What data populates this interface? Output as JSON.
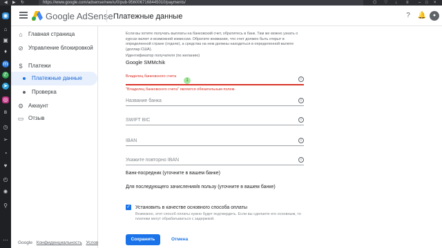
{
  "browser": {
    "url": "https://www.google.com/adsense/new/u/0/pub-9560067168445010/payments/"
  },
  "header": {
    "product_name": "Google AdSense",
    "page_title": "Платежные данные"
  },
  "sidebar": {
    "items": [
      {
        "label": "Главная страница",
        "icon": "home-icon"
      },
      {
        "label": "Управление блокировкой",
        "icon": "block-icon"
      },
      {
        "label": "Платежи",
        "icon": "payments-icon"
      },
      {
        "label": "Платежные данные",
        "icon": "dot"
      },
      {
        "label": "Проверка",
        "icon": "dot"
      },
      {
        "label": "Аккаунт",
        "icon": "gear-icon"
      },
      {
        "label": "Отзыв",
        "icon": "feedback-icon"
      }
    ],
    "footer": {
      "brand": "Google",
      "privacy": "Конфиденциальность",
      "terms": "Условия"
    }
  },
  "form": {
    "info_text": "Если вы хотите получать выплаты на банковский счет, обратитесь в банк. Там же можно узнать о курсах валют и возможной комиссии. Обратите внимание, что счет должен быть открыт в определенной стране (отделе), а средства на нем должны находиться в определенной валюте (доллар США).",
    "recipient_id_label": "Идентификатор получателя (по желанию)",
    "recipient_id_value": "Google SMMchik",
    "account_holder_label": "Владелец банковского счета",
    "account_holder_value": "1",
    "account_holder_error": "\"Владелец банковского счета\" является обязательным полем.",
    "bank_name_placeholder": "Название банка",
    "swift_placeholder": "SWIFT BIC",
    "iban_placeholder": "IBAN",
    "iban_repeat_placeholder": "Укажите повторно IBAN",
    "intermediary_bank": "Банк-посредник (уточните в вашем банке)",
    "further_credit": "Для последующего зачисления/в пользу (уточните в вашем банке)",
    "primary_method_label": "Установить в качестве основного способа оплаты",
    "primary_method_note": "Возможно, этот способ оплаты нужно будет подтвердить. Если вы сделаете его основным, то платежи могут обрабатываться с задержкой.",
    "save_label": "Сохранить",
    "cancel_label": "Отмена",
    "help_glyph": "i"
  },
  "colors": {
    "accent": "#1a73e8",
    "error": "#d93025"
  }
}
